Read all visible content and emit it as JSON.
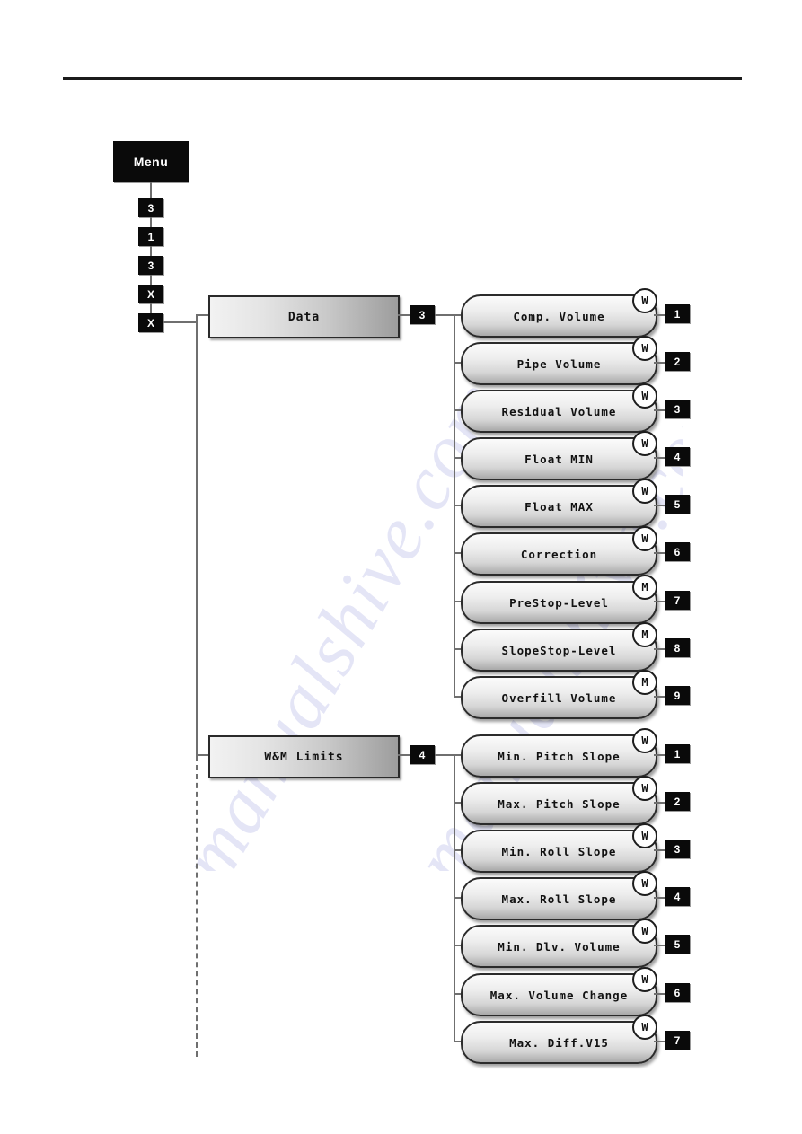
{
  "diagram": {
    "title_box": {
      "label": "Menu"
    },
    "key_sequence": [
      {
        "label": "3"
      },
      {
        "label": "1"
      },
      {
        "label": "3"
      },
      {
        "label": "X"
      },
      {
        "label": "X"
      }
    ],
    "watermark_text": "manualshive.com",
    "groups": [
      {
        "name": "Data",
        "key": "3",
        "items": [
          {
            "index": "1",
            "label": "Comp. Volume",
            "marker": "W"
          },
          {
            "index": "2",
            "label": "Pipe Volume",
            "marker": "W"
          },
          {
            "index": "3",
            "label": "Residual Volume",
            "marker": "W"
          },
          {
            "index": "4",
            "label": "Float MIN",
            "marker": "W"
          },
          {
            "index": "5",
            "label": "Float MAX",
            "marker": "W"
          },
          {
            "index": "6",
            "label": "Correction",
            "marker": "W"
          },
          {
            "index": "7",
            "label": "PreStop-Level",
            "marker": "M"
          },
          {
            "index": "8",
            "label": "SlopeStop-Level",
            "marker": "M"
          },
          {
            "index": "9",
            "label": "Overfill Volume",
            "marker": "M"
          }
        ]
      },
      {
        "name": "W&M Limits",
        "key": "4",
        "items": [
          {
            "index": "1",
            "label": "Min. Pitch Slope",
            "marker": "W"
          },
          {
            "index": "2",
            "label": "Max. Pitch Slope",
            "marker": "W"
          },
          {
            "index": "3",
            "label": "Min. Roll Slope",
            "marker": "W"
          },
          {
            "index": "4",
            "label": "Max. Roll Slope",
            "marker": "W"
          },
          {
            "index": "5",
            "label": "Min. Dlv. Volume",
            "marker": "W"
          },
          {
            "index": "6",
            "label": "Max. Volume Change",
            "marker": "W"
          },
          {
            "index": "7",
            "label": "Max. Diff.V15",
            "marker": "W"
          }
        ]
      }
    ],
    "colors": {
      "badge_background": "#0a0a0a",
      "badge_text": "#ffffff",
      "line": "#6f6f6f",
      "box_border": "#2b2b2b"
    }
  }
}
